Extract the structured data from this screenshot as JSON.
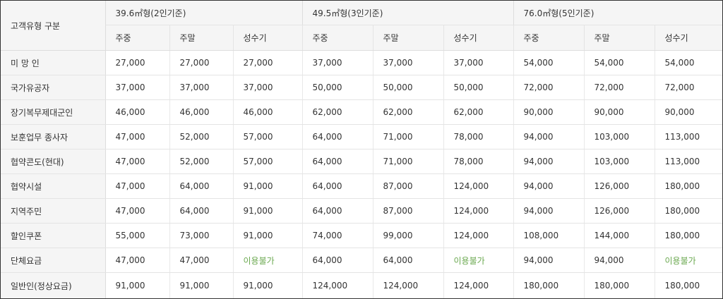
{
  "header": {
    "customer_type_label": "고객유형 구분",
    "groups": [
      {
        "label": "39.6㎡형(2인기준)"
      },
      {
        "label": "49.5㎡형(3인기준)"
      },
      {
        "label": "76.0㎡형(5인기준)"
      }
    ],
    "sub_labels": [
      "주중",
      "주말",
      "성수기"
    ]
  },
  "not_available_color": "#6aa84f",
  "rows": [
    {
      "label": "미 망 인",
      "values": [
        "27,000",
        "27,000",
        "27,000",
        "37,000",
        "37,000",
        "37,000",
        "54,000",
        "54,000",
        "54,000"
      ]
    },
    {
      "label": "국가유공자",
      "values": [
        "37,000",
        "37,000",
        "37,000",
        "50,000",
        "50,000",
        "50,000",
        "72,000",
        "72,000",
        "72,000"
      ]
    },
    {
      "label": "장기복무제대군인",
      "values": [
        "46,000",
        "46,000",
        "46,000",
        "62,000",
        "62,000",
        "62,000",
        "90,000",
        "90,000",
        "90,000"
      ]
    },
    {
      "label": "보훈업무 종사자",
      "values": [
        "47,000",
        "52,000",
        "57,000",
        "64,000",
        "71,000",
        "78,000",
        "94,000",
        "103,000",
        "113,000"
      ]
    },
    {
      "label": "협약콘도(현대)",
      "values": [
        "47,000",
        "52,000",
        "57,000",
        "64,000",
        "71,000",
        "78,000",
        "94,000",
        "103,000",
        "113,000"
      ]
    },
    {
      "label": "협약시설",
      "values": [
        "47,000",
        "64,000",
        "91,000",
        "64,000",
        "87,000",
        "124,000",
        "94,000",
        "126,000",
        "180,000"
      ]
    },
    {
      "label": "지역주민",
      "values": [
        "47,000",
        "64,000",
        "91,000",
        "64,000",
        "87,000",
        "124,000",
        "94,000",
        "126,000",
        "180,000"
      ]
    },
    {
      "label": "할인쿠폰",
      "values": [
        "55,000",
        "73,000",
        "91,000",
        "74,000",
        "99,000",
        "124,000",
        "108,000",
        "144,000",
        "180,000"
      ]
    },
    {
      "label": "단체요금",
      "values": [
        "47,000",
        "47,000",
        "이용불가",
        "64,000",
        "64,000",
        "이용불가",
        "94,000",
        "94,000",
        "이용불가"
      ]
    },
    {
      "label": "일반인(정상요금)",
      "values": [
        "91,000",
        "91,000",
        "91,000",
        "124,000",
        "124,000",
        "124,000",
        "180,000",
        "180,000",
        "180,000"
      ]
    }
  ]
}
